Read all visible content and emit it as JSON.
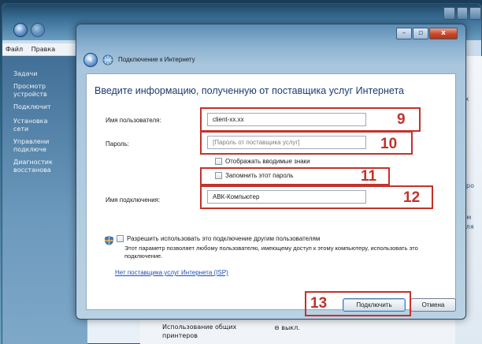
{
  "background": {
    "menu": [
      "Файл",
      "Правка"
    ],
    "sidebar": {
      "heading": "Задачи",
      "items": [
        "Просмотр\nустройств",
        "Подключит",
        "Установка\nсети",
        "Управлени\nподключе",
        "Диагностик\nвосстанова"
      ]
    },
    "right_strip": [
      "й к",
      "стро",
      "ясм",
      "(для"
    ],
    "bottom": {
      "share_label": "Использование общих\nпринтеров",
      "share_value": "⊖ выкл."
    }
  },
  "dialog": {
    "title": "Подключение к Интернету",
    "controls": {
      "minimize": "–",
      "maximize": "▫",
      "close": "x"
    },
    "heading": "Введите информацию, полученную от поставщика услуг Интернета",
    "username": {
      "label": "Имя пользователя:",
      "value": "client-xx.xx"
    },
    "password": {
      "label": "Пароль:",
      "placeholder": "[Пароль от поставщика услуг]"
    },
    "show_chars": {
      "label": "Отображать вводимые знаки",
      "checked": false
    },
    "remember": {
      "label": "Запомнить этот пароль",
      "checked": false
    },
    "connection_name": {
      "label": "Имя подключения:",
      "value": "АВК-Компьютер"
    },
    "allow_others": {
      "label": "Разрешить использовать это подключение другим пользователям",
      "description": "Этот параметр позволяет любому пользователю, имеющему доступ к этому компьютеру, использовать это подключение.",
      "checked": false
    },
    "isp_link": "Нет поставщика услуг Интернета (ISP)",
    "connect_button": "Подключить",
    "cancel_button": "Отмена"
  },
  "annotations": {
    "n9": "9",
    "n10": "10",
    "n11": "11",
    "n12": "12",
    "n13": "13",
    "color": "#c3322b"
  }
}
